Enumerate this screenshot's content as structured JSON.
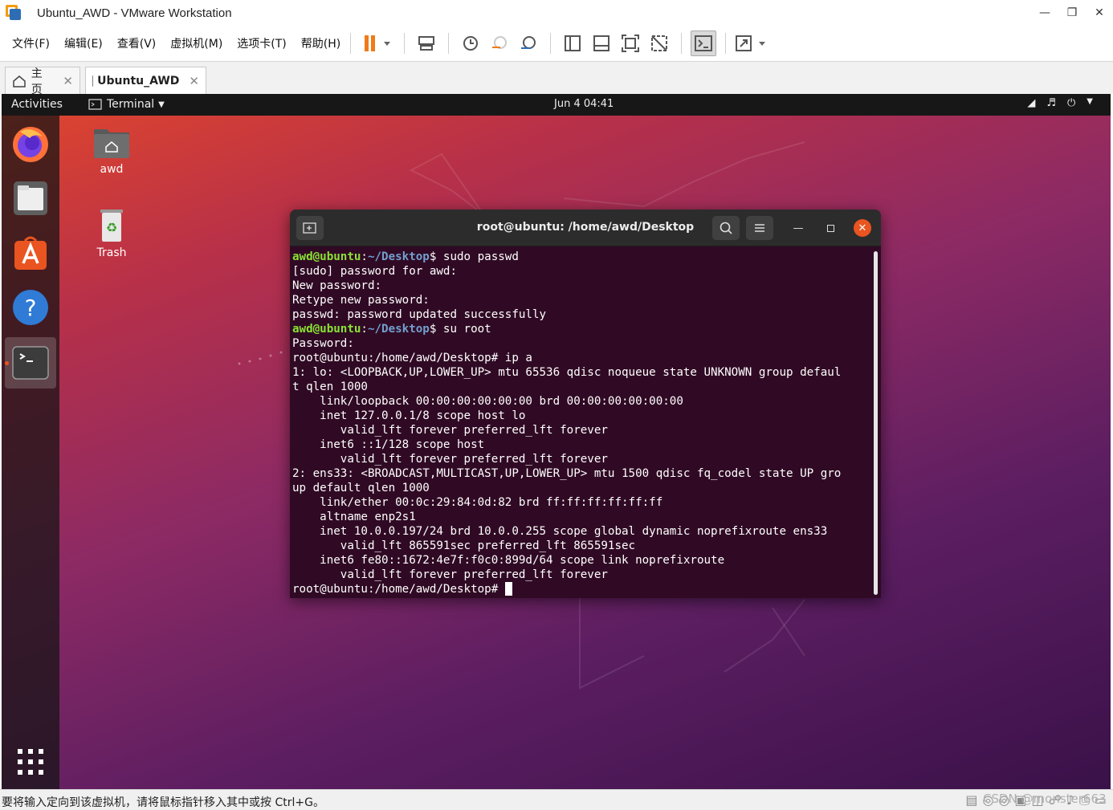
{
  "window": {
    "title": "Ubuntu_AWD - VMware Workstation"
  },
  "menu": [
    "文件(F)",
    "编辑(E)",
    "查看(V)",
    "虚拟机(M)",
    "选项卡(T)",
    "帮助(H)"
  ],
  "tabs": [
    {
      "label": "主页"
    },
    {
      "label": "Ubuntu_AWD"
    }
  ],
  "gnome": {
    "activities": "Activities",
    "app_menu": "Terminal",
    "clock": "Jun 4  04:41"
  },
  "desktop_icons": [
    {
      "label": "awd"
    },
    {
      "label": "Trash"
    }
  ],
  "terminal": {
    "title": "root@ubuntu: /home/awd/Desktop",
    "prompt_user": "awd@ubuntu",
    "prompt_path": "~/Desktop",
    "lines": [
      {
        "kind": "prompt",
        "cmd": " sudo passwd"
      },
      {
        "kind": "text",
        "text": "[sudo] password for awd:"
      },
      {
        "kind": "text",
        "text": "New password:"
      },
      {
        "kind": "text",
        "text": "Retype new password:"
      },
      {
        "kind": "text",
        "text": "passwd: password updated successfully"
      },
      {
        "kind": "prompt",
        "cmd": " su root"
      },
      {
        "kind": "text",
        "text": "Password:"
      },
      {
        "kind": "text",
        "text": "root@ubuntu:/home/awd/Desktop# ip a"
      },
      {
        "kind": "text",
        "text": "1: lo: <LOOPBACK,UP,LOWER_UP> mtu 65536 qdisc noqueue state UNKNOWN group defaul"
      },
      {
        "kind": "text",
        "text": "t qlen 1000"
      },
      {
        "kind": "text",
        "text": "    link/loopback 00:00:00:00:00:00 brd 00:00:00:00:00:00"
      },
      {
        "kind": "text",
        "text": "    inet 127.0.0.1/8 scope host lo"
      },
      {
        "kind": "text",
        "text": "       valid_lft forever preferred_lft forever"
      },
      {
        "kind": "text",
        "text": "    inet6 ::1/128 scope host"
      },
      {
        "kind": "text",
        "text": "       valid_lft forever preferred_lft forever"
      },
      {
        "kind": "text",
        "text": "2: ens33: <BROADCAST,MULTICAST,UP,LOWER_UP> mtu 1500 qdisc fq_codel state UP gro"
      },
      {
        "kind": "text",
        "text": "up default qlen 1000"
      },
      {
        "kind": "text",
        "text": "    link/ether 00:0c:29:84:0d:82 brd ff:ff:ff:ff:ff:ff"
      },
      {
        "kind": "text",
        "text": "    altname enp2s1"
      },
      {
        "kind": "text",
        "text": "    inet 10.0.0.197/24 brd 10.0.0.255 scope global dynamic noprefixroute ens33"
      },
      {
        "kind": "text",
        "text": "       valid_lft 865591sec preferred_lft 865591sec"
      },
      {
        "kind": "text",
        "text": "    inet6 fe80::1672:4e7f:f0c0:899d/64 scope link noprefixroute"
      },
      {
        "kind": "text",
        "text": "       valid_lft forever preferred_lft forever"
      },
      {
        "kind": "cursor",
        "text": "root@ubuntu:/home/awd/Desktop# "
      }
    ]
  },
  "status": {
    "message": "要将输入定向到该虚拟机，请将鼠标指针移入其中或按 Ctrl+G。",
    "watermark": "CSDN @monster663"
  },
  "colors": {
    "ubuntu_orange": "#e95420",
    "terminal_bg": "#300a24",
    "prompt_green": "#8ae234",
    "prompt_blue": "#729fcf",
    "pause_orange": "#f07a19"
  }
}
